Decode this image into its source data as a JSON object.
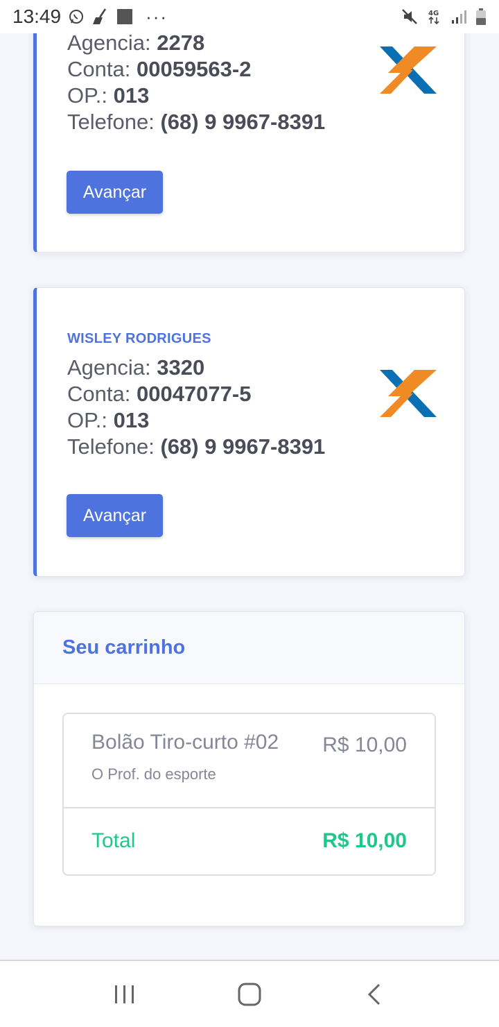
{
  "status_bar": {
    "time": "13:49",
    "network": "4G",
    "icons": [
      "whatsapp-icon",
      "broom-icon",
      "square-icon",
      "more-dots-icon",
      "mute-icon",
      "network-4g-icon",
      "signal-icon",
      "battery-icon"
    ]
  },
  "banks": [
    {
      "holder": "",
      "agencia_label": "Agencia:",
      "agencia": "2278",
      "conta_label": "Conta:",
      "conta": "00059563-2",
      "op_label": "OP.:",
      "op": "013",
      "telefone_label": "Telefone:",
      "telefone": "(68) 9 9967-8391",
      "button_label": "Avançar",
      "logo": "caixa-logo-icon"
    },
    {
      "holder": "WISLEY RODRIGUES",
      "agencia_label": "Agencia:",
      "agencia": "3320",
      "conta_label": "Conta:",
      "conta": "00047077-5",
      "op_label": "OP.:",
      "op": "013",
      "telefone_label": "Telefone:",
      "telefone": "(68) 9 9967-8391",
      "button_label": "Avançar",
      "logo": "caixa-logo-icon"
    }
  ],
  "cart": {
    "title": "Seu carrinho",
    "item_name": "Bolão Tiro-curto #02",
    "item_price": "R$ 10,00",
    "item_subtitle": "O Prof. do esporte",
    "total_label": "Total",
    "total_value": "R$ 10,00"
  },
  "nav": {
    "icons": [
      "recent-apps-icon",
      "home-icon",
      "back-icon"
    ]
  },
  "colors": {
    "primary": "#4e73df",
    "success": "#1cc88a",
    "caixa_blue": "#0a6fb3",
    "caixa_orange": "#f08a24"
  }
}
